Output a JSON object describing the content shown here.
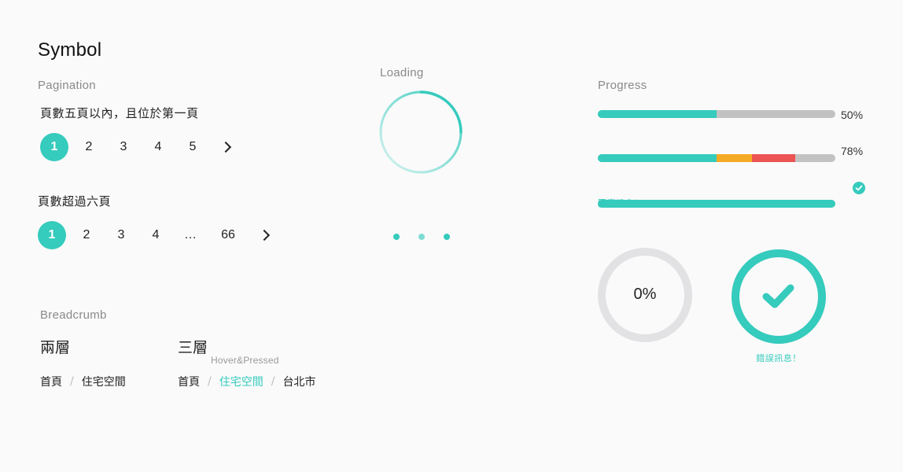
{
  "title": "Symbol",
  "pagination": {
    "label": "Pagination",
    "case1": {
      "desc": "頁數五頁以內，且位於第一頁",
      "pages": [
        "1",
        "2",
        "3",
        "4",
        "5"
      ],
      "active": "1"
    },
    "case2": {
      "desc": "頁數超過六頁",
      "pages": [
        "1",
        "2",
        "3",
        "4",
        "…",
        "66"
      ],
      "active": "1"
    },
    "next_icon": "chevron-right-icon"
  },
  "breadcrumb": {
    "label": "Breadcrumb",
    "two_level": {
      "title": "兩層",
      "items": [
        "首頁",
        "住宅空間"
      ]
    },
    "three_level": {
      "title": "三層",
      "hover_note": "Hover&Pressed",
      "items": [
        "首頁",
        "住宅空間",
        "台北市"
      ]
    },
    "separator": "/"
  },
  "loading": {
    "label": "Loading"
  },
  "progress": {
    "label": "Progress",
    "bar1": {
      "value": 0.5,
      "text": "50%"
    },
    "bar2": {
      "text": "78%",
      "segments": [
        {
          "value": 0.5,
          "color": "#35cbbd"
        },
        {
          "value": 0.15,
          "color": "#f5aa25"
        },
        {
          "value": 0.18,
          "color": "#ec5353"
        }
      ]
    },
    "bar3": {
      "value": 1.0,
      "message": "回應訊息！"
    },
    "ring_empty": {
      "value": 0,
      "text": "0%"
    },
    "ring_done": {
      "value": 1.0,
      "message": "錯誤訊息！"
    }
  },
  "colors": {
    "accent": "#35cbbd",
    "track": "#c2c2c2",
    "warning": "#f5aa25",
    "error": "#ec5353",
    "ring_bg": "#e2e2e4"
  }
}
